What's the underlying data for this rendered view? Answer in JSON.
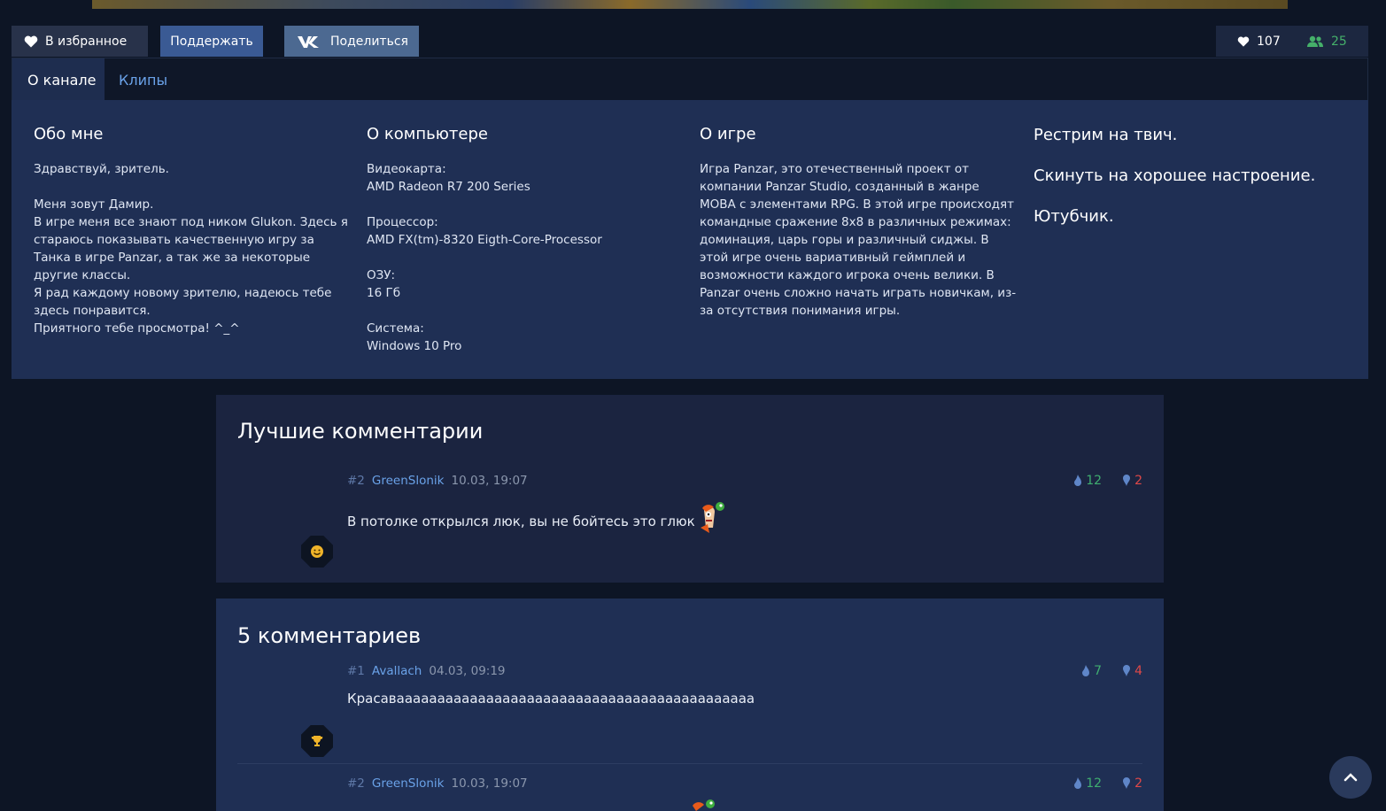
{
  "toolbar": {
    "favorite_label": "В избранное",
    "support_label": "Поддержать",
    "share_label": "Поделиться",
    "likes": "107",
    "followers": "25"
  },
  "tabs": [
    {
      "label": "О канале",
      "active": true
    },
    {
      "label": "Клипы",
      "active": false
    }
  ],
  "about": {
    "me": {
      "title": "Обо мне",
      "text": "Здравствуй, зритель.\n\nМеня зовут Дамир.\nВ игре меня все знают под ником Glukon. Здесь я стараюсь показывать качественную игру за Танка в игре Panzar, а так же за некоторые другие классы.\nЯ рад каждому новому зрителю, надеюсь тебе здесь понравится.\nПриятного тебе просмотра! ^_^"
    },
    "pc": {
      "title": "О компьютере",
      "text": "Видеокарта:\nAMD Radeon R7 200 Series\n\nПроцессор:\nAMD FX(tm)-8320 Eigth-Core-Processor\n\nОЗУ:\n16 Гб\n\nСистема:\nWindows 10 Pro"
    },
    "game": {
      "title": "О игре",
      "text": "Игра Panzar, это отечественный проект от компании Panzar Studio, созданный в жанре MOBA с элементами RPG. В этой игре происходят командные сражение 8х8 в различных режимах: доминация, царь горы и различный сиджы. В этой игре очень вариативный геймплей и возможности каждого игрока очень велики. В Panzar очень сложно начать играть новичкам, из-за отсутствия понимания игры."
    },
    "extra": {
      "line1": "Рестрим на твич.",
      "line2": "Скинуть на хорошее настроение.",
      "line3": "Ютубчик."
    }
  },
  "best_comments": {
    "title": "Лучшие комментарии",
    "items": [
      {
        "num": "#2",
        "author": "GreenSlonik",
        "date": "10.03, 19:07",
        "text": "В потолке открылся люк, вы не бойтесь это глюк",
        "up": "12",
        "down": "2"
      }
    ]
  },
  "all_comments": {
    "title": "5 комментариев",
    "items": [
      {
        "num": "#1",
        "author": "Avallach",
        "date": "04.03, 09:19",
        "text": "Красаваааааааааааааааааааааааааааааааааааааааааааа",
        "up": "7",
        "down": "4"
      },
      {
        "num": "#2",
        "author": "GreenSlonik",
        "date": "10.03, 19:07",
        "text": "",
        "up": "12",
        "down": "2"
      }
    ]
  },
  "colors": {
    "background": "#0d1525",
    "panel": "#1f2f54",
    "accent_link": "#6aa2e8",
    "vote_up": "#3fae70",
    "vote_down": "#e04848",
    "followers": "#45b06a"
  },
  "icons": {
    "favorite": "heart-icon",
    "share": "vk-icon",
    "followers": "users-icon",
    "like_vote": "thumb-up-icon",
    "dislike_vote": "thumb-down-icon",
    "badge1": "emoji-badge-icon",
    "badge2": "trophy-badge-icon",
    "scroll": "chevron-up-icon"
  }
}
